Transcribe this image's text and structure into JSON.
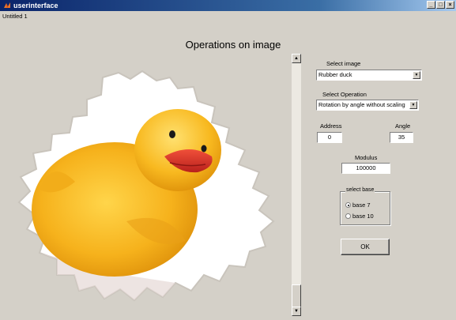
{
  "window": {
    "title": "userinterface",
    "document": "Untitled 1",
    "buttons": {
      "minimize": "_",
      "maximize": "□",
      "close": "×"
    }
  },
  "figure": {
    "title": "Operations on image",
    "image": "rubber-duck-in-fractal-frame"
  },
  "panel": {
    "select_image_label": "Select image",
    "select_image_value": "Rubber duck",
    "select_operation_label": "Select Operation",
    "select_operation_value": "Rotation by angle without scaling",
    "address_label": "Address",
    "address_value": "0",
    "angle_label": "Angle",
    "angle_value": "35",
    "modulus_label": "Modulus",
    "modulus_value": "100000",
    "base_group_label": "select base",
    "base_options": [
      {
        "label": "base 7",
        "selected": true
      },
      {
        "label": "base 10",
        "selected": false
      }
    ],
    "ok_label": "OK"
  },
  "icons": {
    "app": "matlab-logo-icon",
    "scroll_up": "▲",
    "scroll_down": "▼",
    "dropdown": "▼"
  }
}
